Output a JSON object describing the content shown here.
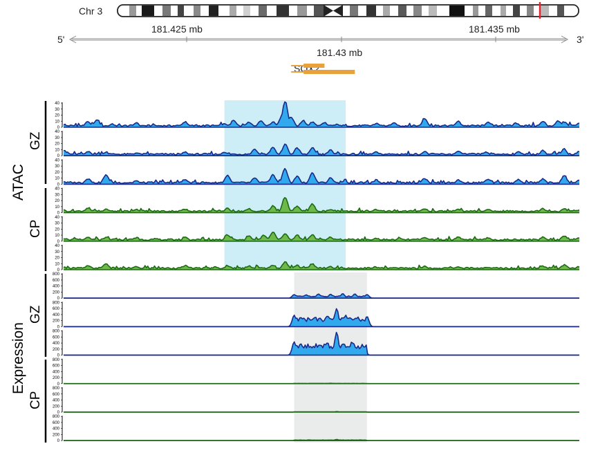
{
  "ideogram": {
    "chromosome_label": "Chr 3",
    "left_strand": "5'",
    "right_strand": "3'",
    "coordinate_ticks": [
      "181.425 mb",
      "181.43 mb",
      "181.435 mb"
    ],
    "highlight_color": "#e8222d"
  },
  "gene": {
    "name": "SOX2",
    "color": "#e9a23b"
  },
  "groups": {
    "atac_label": "ATAC",
    "expression_label": "Expression",
    "gz_label": "GZ",
    "cp_label": "CP"
  },
  "colors": {
    "gz_line": "#1a2a8c",
    "gz_fill": "#31a9ec",
    "cp_line": "#1a6b12",
    "cp_fill": "#6fb84a",
    "atac_highlight": "#cdeef6",
    "expression_highlight": "#eaeceb"
  },
  "chart_data": {
    "type": "area",
    "x_range_mb": [
      181.4222,
      181.4392
    ],
    "atac_highlight_mb": [
      181.4275,
      181.4315
    ],
    "expression_highlight_mb": [
      181.4298,
      181.4322
    ],
    "gene_models": [
      {
        "start_mb": 181.4297,
        "end_mb": 181.4308,
        "strand": "+"
      },
      {
        "start_mb": 181.4297,
        "end_mb": 181.4318,
        "strand": "+"
      }
    ],
    "tracks": [
      {
        "assay": "ATAC",
        "tissue": "GZ",
        "ylim": [
          0,
          40
        ],
        "ticks": [
          0,
          10,
          20,
          30,
          40
        ],
        "peaks": [
          [
            181.4222,
            3
          ],
          [
            181.423,
            9
          ],
          [
            181.4233,
            12
          ],
          [
            181.4238,
            4
          ],
          [
            181.4246,
            6
          ],
          [
            181.4262,
            8
          ],
          [
            181.4275,
            5
          ],
          [
            181.4278,
            10
          ],
          [
            181.4283,
            7
          ],
          [
            181.4287,
            9
          ],
          [
            181.4291,
            8
          ],
          [
            181.4294,
            18
          ],
          [
            181.4295,
            42
          ],
          [
            181.4297,
            16
          ],
          [
            181.4301,
            10
          ],
          [
            181.4304,
            8
          ],
          [
            181.4308,
            6
          ],
          [
            181.4312,
            4
          ],
          [
            181.4325,
            5
          ],
          [
            181.4331,
            7
          ],
          [
            181.4341,
            14
          ],
          [
            181.4352,
            9
          ],
          [
            181.4362,
            7
          ],
          [
            181.4371,
            6
          ],
          [
            181.438,
            9
          ],
          [
            181.4385,
            10
          ],
          [
            181.4387,
            8
          ],
          [
            181.4392,
            5
          ]
        ]
      },
      {
        "assay": "ATAC",
        "tissue": "GZ",
        "ylim": [
          0,
          40
        ],
        "ticks": [
          0,
          10,
          20,
          30,
          40
        ],
        "peaks": [
          [
            181.4222,
            8
          ],
          [
            181.423,
            6
          ],
          [
            181.4236,
            5
          ],
          [
            181.4246,
            4
          ],
          [
            181.4262,
            5
          ],
          [
            181.4275,
            5
          ],
          [
            181.4285,
            10
          ],
          [
            181.4291,
            13
          ],
          [
            181.4295,
            18
          ],
          [
            181.4299,
            12
          ],
          [
            181.4304,
            12
          ],
          [
            181.431,
            8
          ],
          [
            181.4325,
            5
          ],
          [
            181.4341,
            6
          ],
          [
            181.4352,
            7
          ],
          [
            181.4361,
            5
          ],
          [
            181.4372,
            6
          ],
          [
            181.438,
            8
          ],
          [
            181.4387,
            10
          ],
          [
            181.4392,
            6
          ]
        ]
      },
      {
        "assay": "ATAC",
        "tissue": "GZ",
        "ylim": [
          0,
          40
        ],
        "ticks": [
          0,
          10,
          20,
          30,
          40
        ],
        "peaks": [
          [
            181.4222,
            4
          ],
          [
            181.423,
            8
          ],
          [
            181.4236,
            14
          ],
          [
            181.4246,
            5
          ],
          [
            181.4262,
            7
          ],
          [
            181.4276,
            14
          ],
          [
            181.4285,
            10
          ],
          [
            181.4291,
            15
          ],
          [
            181.4295,
            25
          ],
          [
            181.4299,
            12
          ],
          [
            181.4304,
            18
          ],
          [
            181.431,
            10
          ],
          [
            181.4325,
            6
          ],
          [
            181.4341,
            9
          ],
          [
            181.4352,
            6
          ],
          [
            181.4362,
            8
          ],
          [
            181.4372,
            7
          ],
          [
            181.438,
            8
          ],
          [
            181.4387,
            14
          ],
          [
            181.4392,
            6
          ]
        ]
      },
      {
        "assay": "ATAC",
        "tissue": "CP",
        "ylim": [
          0,
          40
        ],
        "ticks": [
          0,
          10,
          20,
          30,
          40
        ],
        "peaks": [
          [
            181.4222,
            3
          ],
          [
            181.423,
            6
          ],
          [
            181.4236,
            5
          ],
          [
            181.4246,
            4
          ],
          [
            181.4262,
            5
          ],
          [
            181.4276,
            6
          ],
          [
            181.4283,
            6
          ],
          [
            181.4291,
            10
          ],
          [
            181.4295,
            25
          ],
          [
            181.4299,
            10
          ],
          [
            181.4304,
            14
          ],
          [
            181.431,
            5
          ],
          [
            181.4325,
            4
          ],
          [
            181.4341,
            6
          ],
          [
            181.4352,
            5
          ],
          [
            181.4362,
            4
          ],
          [
            181.438,
            6
          ],
          [
            181.4387,
            5
          ],
          [
            181.4392,
            3
          ]
        ]
      },
      {
        "assay": "ATAC",
        "tissue": "CP",
        "ylim": [
          0,
          40
        ],
        "ticks": [
          0,
          10,
          20,
          30,
          40
        ],
        "peaks": [
          [
            181.4222,
            4
          ],
          [
            181.423,
            5
          ],
          [
            181.4236,
            6
          ],
          [
            181.4246,
            5
          ],
          [
            181.4262,
            5
          ],
          [
            181.4276,
            10
          ],
          [
            181.4283,
            8
          ],
          [
            181.4288,
            9
          ],
          [
            181.4291,
            14
          ],
          [
            181.4295,
            12
          ],
          [
            181.4299,
            9
          ],
          [
            181.4304,
            10
          ],
          [
            181.431,
            6
          ],
          [
            181.4325,
            4
          ],
          [
            181.4341,
            5
          ],
          [
            181.4352,
            6
          ],
          [
            181.4362,
            4
          ],
          [
            181.438,
            6
          ],
          [
            181.4387,
            8
          ],
          [
            181.4392,
            4
          ]
        ]
      },
      {
        "assay": "ATAC",
        "tissue": "CP",
        "ylim": [
          0,
          40
        ],
        "ticks": [
          0,
          10,
          20,
          30,
          40
        ],
        "peaks": [
          [
            181.4222,
            3
          ],
          [
            181.423,
            5
          ],
          [
            181.4236,
            9
          ],
          [
            181.4246,
            4
          ],
          [
            181.4262,
            6
          ],
          [
            181.4276,
            6
          ],
          [
            181.4283,
            5
          ],
          [
            181.4291,
            7
          ],
          [
            181.4295,
            12
          ],
          [
            181.4299,
            6
          ],
          [
            181.4304,
            9
          ],
          [
            181.431,
            4
          ],
          [
            181.4325,
            3
          ],
          [
            181.4341,
            5
          ],
          [
            181.4352,
            4
          ],
          [
            181.4362,
            3
          ],
          [
            181.438,
            5
          ],
          [
            181.4387,
            7
          ],
          [
            181.4392,
            3
          ]
        ]
      },
      {
        "assay": "Expression",
        "tissue": "GZ",
        "ylim": [
          0,
          800
        ],
        "ticks": [
          0,
          200,
          400,
          600,
          800
        ],
        "peaks": [
          [
            181.4298,
            120
          ],
          [
            181.4302,
            110
          ],
          [
            181.4306,
            140
          ],
          [
            181.431,
            130
          ],
          [
            181.4314,
            150
          ],
          [
            181.4318,
            140
          ],
          [
            181.4322,
            120
          ]
        ]
      },
      {
        "assay": "Expression",
        "tissue": "GZ",
        "ylim": [
          0,
          800
        ],
        "ticks": [
          0,
          200,
          400,
          600,
          800
        ],
        "peaks": [
          [
            181.4298,
            380
          ],
          [
            181.43,
            300
          ],
          [
            181.4303,
            260
          ],
          [
            181.4305,
            320
          ],
          [
            181.4309,
            360
          ],
          [
            181.4312,
            600
          ],
          [
            181.4315,
            380
          ],
          [
            181.4319,
            320
          ],
          [
            181.4322,
            340
          ]
        ]
      },
      {
        "assay": "Expression",
        "tissue": "GZ",
        "ylim": [
          0,
          800
        ],
        "ticks": [
          0,
          200,
          400,
          600,
          800
        ],
        "peaks": [
          [
            181.4298,
            440
          ],
          [
            181.43,
            320
          ],
          [
            181.4303,
            260
          ],
          [
            181.4306,
            300
          ],
          [
            181.4309,
            420
          ],
          [
            181.4312,
            760
          ],
          [
            181.4314,
            380
          ],
          [
            181.4317,
            440
          ],
          [
            181.4321,
            280
          ]
        ]
      },
      {
        "assay": "Expression",
        "tissue": "CP",
        "ylim": [
          0,
          800
        ],
        "ticks": [
          0,
          200,
          400,
          600,
          800
        ],
        "peaks": [
          [
            181.431,
            14
          ],
          [
            181.4315,
            8
          ]
        ]
      },
      {
        "assay": "Expression",
        "tissue": "CP",
        "ylim": [
          0,
          800
        ],
        "ticks": [
          0,
          200,
          400,
          600,
          800
        ],
        "peaks": [
          [
            181.4312,
            18
          ]
        ]
      },
      {
        "assay": "Expression",
        "tissue": "CP",
        "ylim": [
          0,
          800
        ],
        "ticks": [
          0,
          200,
          400,
          600,
          800
        ],
        "peaks": [
          [
            181.4306,
            16
          ],
          [
            181.4312,
            40
          ],
          [
            181.4318,
            12
          ]
        ]
      }
    ]
  }
}
